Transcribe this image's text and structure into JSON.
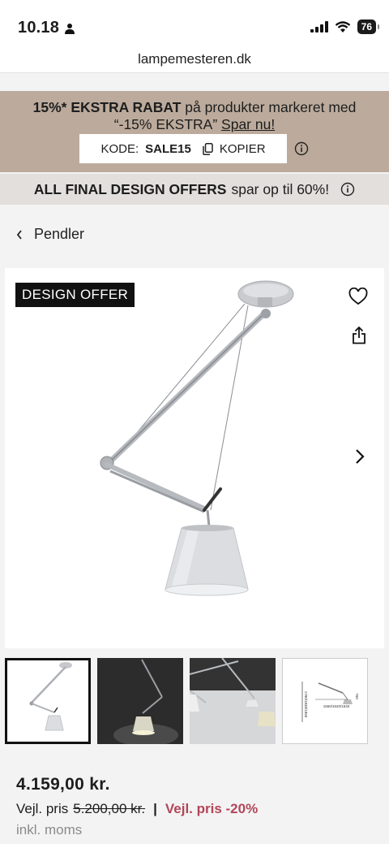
{
  "status_bar": {
    "time": "10.18",
    "battery": "76"
  },
  "browser": {
    "url": "lampemesteren.dk"
  },
  "promo": {
    "bold_text": "15%* EKSTRA RABAT",
    "text": " på produkter markeret med “-15% EKSTRA” ",
    "link": "Spar nu!",
    "code_label": "KODE:",
    "code": "SALE15",
    "copy_label": "KOPIER"
  },
  "offers_banner": {
    "bold_text": "ALL FINAL DESIGN OFFERS",
    "text": "spar op til 60%!"
  },
  "breadcrumb": {
    "label": "Pendler"
  },
  "product": {
    "badge": "DESIGN OFFER",
    "price": "4.159,00 kr.",
    "rrp_label": "Vejl. pris",
    "rrp_value": "5.200,00 kr.",
    "separator": "|",
    "discount": "Vejl. pris -20%",
    "vat_note": "inkl. moms"
  },
  "thumbnails": {
    "t4_dims_a": "1560/1620/1640",
    "t4_dims_b": "1780/1830/1860",
    "t4_dims_c": "760"
  },
  "colors": {
    "promo_bg": "#bcab9c",
    "offers_bg": "#e3dfdc",
    "discount": "#b2465a",
    "badge_bg": "#111111"
  },
  "icons": [
    "person-icon",
    "signal-icon",
    "wifi-icon",
    "battery-icon",
    "copy-icon",
    "info-icon",
    "chevron-left-icon",
    "heart-icon",
    "share-icon",
    "chevron-right-icon"
  ]
}
